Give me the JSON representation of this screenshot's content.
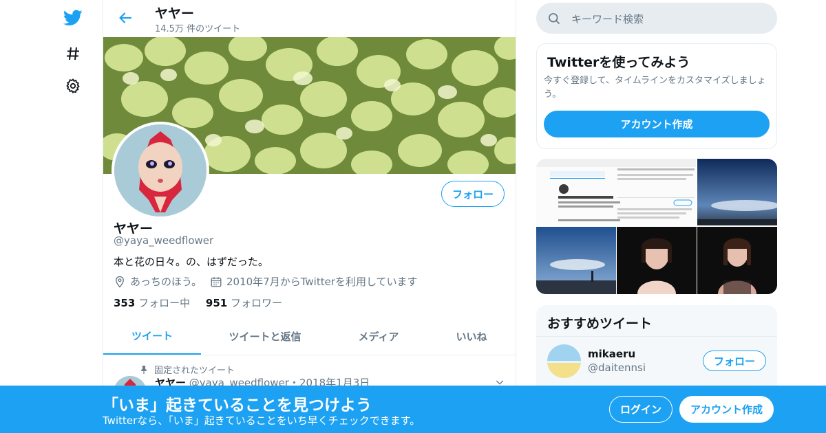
{
  "colors": {
    "accent": "#1da1f2",
    "muted": "#657786",
    "text": "#0f1419",
    "border": "#e6ecf0"
  },
  "header": {
    "name": "ヤヤー",
    "tweet_count": "14.5万 件のツイート"
  },
  "profile": {
    "follow_label": "フォロー",
    "name": "ヤヤー",
    "handle": "@yaya_weedflower",
    "bio": "本と花の日々。の、はずだった。",
    "location": "あっちのほう。",
    "joined": "2010年7月からTwitterを利用しています",
    "following_count": "353",
    "following_label": "フォロー中",
    "followers_count": "951",
    "followers_label": "フォロワー"
  },
  "tabs": [
    {
      "label": "ツイート"
    },
    {
      "label": "ツイートと返信"
    },
    {
      "label": "メディア"
    },
    {
      "label": "いいね"
    }
  ],
  "pinned": {
    "label": "固定されたツイート",
    "name": "ヤヤー",
    "handle_date": "@yaya_weedflower・2018年1月3日"
  },
  "search": {
    "placeholder": "キーワード検索"
  },
  "signup_card": {
    "title": "Twitterを使ってみよう",
    "desc": "今すぐ登録して、タイムラインをカスタマイズしましょう。",
    "button": "アカウント作成"
  },
  "recommend": {
    "title": "おすすめツイート",
    "user_name": "mikaeru",
    "user_handle": "@daitennsi",
    "follow_label": "フォロー"
  },
  "bottom_bar": {
    "title": "「いま」起きていることを見つけよう",
    "subtitle": "Twitterなら、「いま」起きていることをいち早くチェックできます。",
    "login": "ログイン",
    "signup": "アカウント作成"
  }
}
